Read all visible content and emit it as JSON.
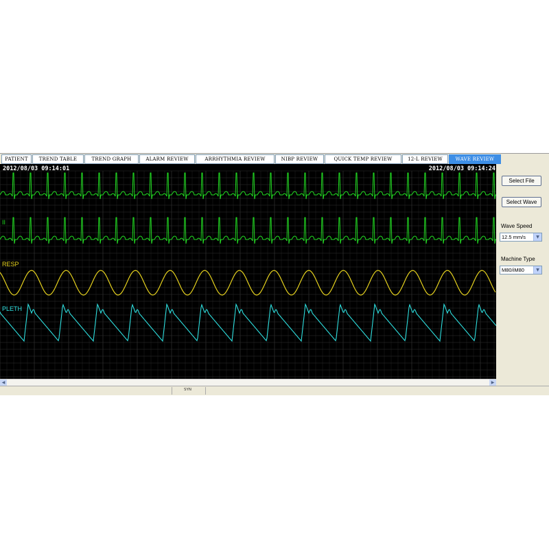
{
  "tabs": [
    {
      "label": "PATIENT",
      "active": false
    },
    {
      "label": "TREND TABLE",
      "active": false
    },
    {
      "label": "TREND GRAPH",
      "active": false
    },
    {
      "label": "ALARM REVIEW",
      "active": false
    },
    {
      "label": "ARRHYTHMIA REVIEW",
      "active": false
    },
    {
      "label": "NIBP REVIEW",
      "active": false
    },
    {
      "label": "QUICK TEMP REVIEW",
      "active": false
    },
    {
      "label": "12-L REVIEW",
      "active": false
    },
    {
      "label": "WAVE REVIEW",
      "active": true
    }
  ],
  "review": {
    "start_time": "2012/08/03 09:14:01",
    "end_time": "2012/08/03 09:14:24"
  },
  "waves": [
    {
      "label": "",
      "color": "#22dd22"
    },
    {
      "label": "II",
      "color": "#22dd22"
    },
    {
      "label": "RESP",
      "color": "#e6d21e"
    },
    {
      "label": "PLETH",
      "color": "#2ee0e0"
    }
  ],
  "sidebar": {
    "select_file": "Select File",
    "select_wave": "Select Wave",
    "wave_speed_label": "Wave Speed",
    "wave_speed_value": "12.5 mm/s",
    "machine_type_label": "Machine Type",
    "machine_type_value": "M80/iM80"
  },
  "status": {
    "text": "SYN"
  },
  "colors": {
    "active_tab": "#3d8ee6",
    "background": "#000000",
    "grid": "#3a3a3a"
  },
  "icons": {
    "scroll_left": "triangle-left-icon",
    "scroll_right": "triangle-right-icon",
    "combo_arrow": "chevron-down-icon"
  }
}
